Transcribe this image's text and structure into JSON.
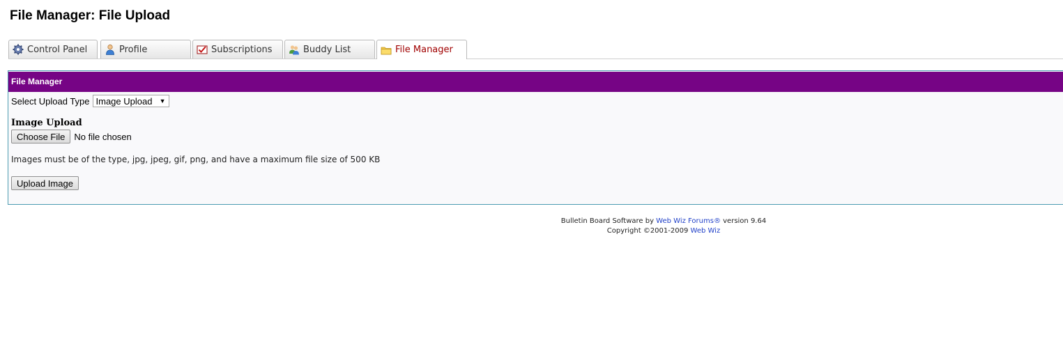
{
  "page": {
    "title": "File Manager: File Upload"
  },
  "tabs": [
    {
      "label": "Control Panel",
      "icon": "gear-icon"
    },
    {
      "label": "Profile",
      "icon": "user-icon"
    },
    {
      "label": "Subscriptions",
      "icon": "checklist-icon"
    },
    {
      "label": "Buddy List",
      "icon": "buddies-icon"
    },
    {
      "label": "File Manager",
      "icon": "folder-icon",
      "active": true
    }
  ],
  "panel": {
    "header": "File Manager",
    "upload_type_label": "Select Upload Type",
    "upload_type_value": "Image Upload",
    "section_title": "Image Upload",
    "choose_file_label": "Choose File",
    "no_file_text": "No file chosen",
    "info_text": "Images must be of the type, jpg, jpeg, gif, png, and have a maximum file size of 500 KB",
    "upload_button": "Upload Image"
  },
  "footer": {
    "line1_prefix": "Bulletin Board Software by",
    "line1_link": "Web Wiz Forums®",
    "line1_suffix": "version 9.64",
    "line2_prefix": "Copyright ©2001-2009",
    "line2_link": "Web Wiz"
  },
  "colors": {
    "header_bg": "#760485",
    "panel_border": "#4a9ab0",
    "active_tab_text": "#a00000",
    "link": "#2040c8"
  }
}
